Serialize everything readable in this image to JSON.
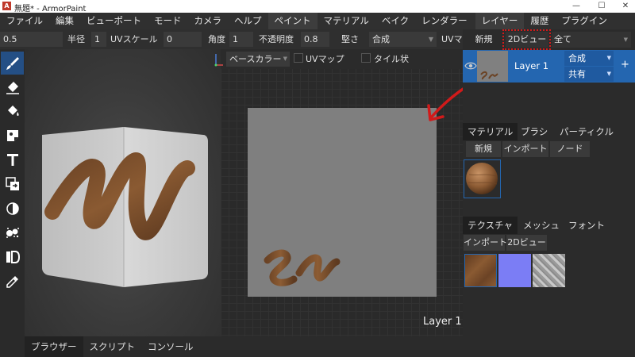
{
  "window": {
    "app_letter": "A",
    "title": "無題* - ArmorPaint",
    "minimize": "—",
    "maximize": "☐",
    "close": "✕"
  },
  "menu": [
    "ファイル",
    "編集",
    "ビューポート",
    "モード",
    "カメラ",
    "ヘルプ",
    "ペイント",
    "マテリアル",
    "ベイク",
    "レンダラー",
    "レイヤー",
    "履歴",
    "プラグイン"
  ],
  "menu_active": [
    "ペイント",
    "レイヤー"
  ],
  "toolbar": {
    "radius_value": "0.5",
    "radius_label": "半径",
    "uv_scale_value": "1",
    "uv_scale_label": "UVスケール",
    "angle_value": "0",
    "angle_label": "角度",
    "opacity_value": "1",
    "opacity_label": "不透明度",
    "hardness_value": "0.8",
    "hardness_label": "堅さ",
    "blend_value": "合成",
    "uv_map_label": "UVマ"
  },
  "tools": [
    "brush-icon",
    "eraser-icon",
    "fill-icon",
    "decal-icon",
    "text-icon",
    "clone-icon",
    "blur-icon",
    "particle-icon",
    "bake-icon",
    "picker-icon"
  ],
  "view2d": {
    "channel_value": "ベースカラー",
    "uv_map_label": "UVマップ",
    "tiled_label": "タイル状",
    "layer_label": "Layer 1"
  },
  "bottom_tabs": [
    "ブラウザー",
    "スクリプト",
    "コンソール"
  ],
  "layers_panel": {
    "new_label": "新規",
    "view2d_label": "2Dビュー",
    "filter_value": "全て",
    "layer_name": "Layer 1",
    "layer_blend": "合成",
    "layer_mode": "共有",
    "add_label": "+"
  },
  "materials_panel": {
    "tabs": [
      "マテリアル",
      "ブラシ",
      "パーティクル"
    ],
    "new_label": "新規",
    "import_label": "インポート",
    "node_label": "ノード"
  },
  "textures_panel": {
    "tabs": [
      "テクスチャ",
      "メッシュ",
      "フォント"
    ],
    "import_label": "インポート",
    "view2d_label": "2Dビュー",
    "textures": [
      "wood-texture",
      "normal-map-texture",
      "stone-texture"
    ]
  },
  "colors": {
    "accent": "#2466b0",
    "annotation_red": "#d11a1a",
    "canvas_gray": "#7f7f7f",
    "normal_map": "#7b7df5"
  }
}
